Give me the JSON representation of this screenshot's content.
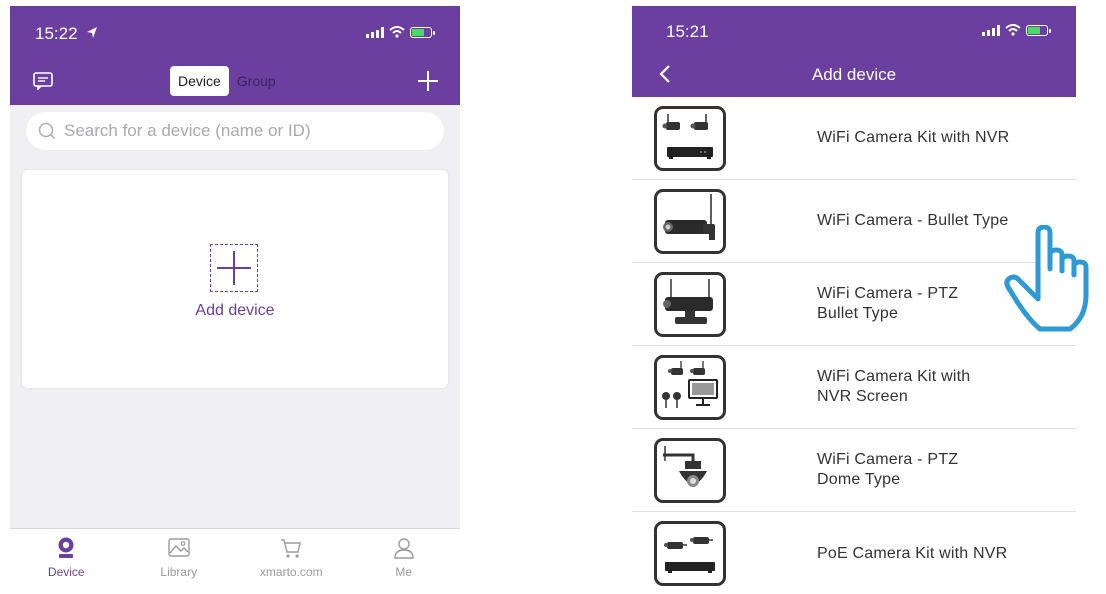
{
  "left": {
    "status_time": "15:22",
    "tabs_segment": {
      "device": "Device",
      "group": "Group"
    },
    "search": {
      "placeholder": "Search for a device (name or ID)"
    },
    "add_device_label": "Add device",
    "tabbar": [
      {
        "label": "Device",
        "icon": "camera-icon"
      },
      {
        "label": "Library",
        "icon": "image-icon"
      },
      {
        "label": "xmarto.com",
        "icon": "cart-icon"
      },
      {
        "label": "Me",
        "icon": "user-icon"
      }
    ]
  },
  "right": {
    "status_time": "15:21",
    "title": "Add device",
    "devices": [
      {
        "line1": "WiFi Camera Kit with NVR",
        "line2": "",
        "icon": "camera-kit-nvr-icon"
      },
      {
        "line1": "WiFi Camera - Bullet Type",
        "line2": "",
        "icon": "bullet-camera-icon"
      },
      {
        "line1": "WiFi Camera - PTZ",
        "line2": "Bullet Type",
        "icon": "ptz-bullet-camera-icon"
      },
      {
        "line1": "WiFi Camera Kit with",
        "line2": "NVR Screen",
        "icon": "camera-kit-screen-icon"
      },
      {
        "line1": "WiFi Camera - PTZ",
        "line2": "Dome Type",
        "icon": "ptz-dome-camera-icon"
      },
      {
        "line1": "PoE Camera Kit with NVR",
        "line2": "",
        "icon": "poe-camera-kit-icon"
      }
    ]
  },
  "colors": {
    "brand": "#6a3fa0",
    "background": "#efeff4",
    "tab_inactive": "#9a9aa0"
  }
}
